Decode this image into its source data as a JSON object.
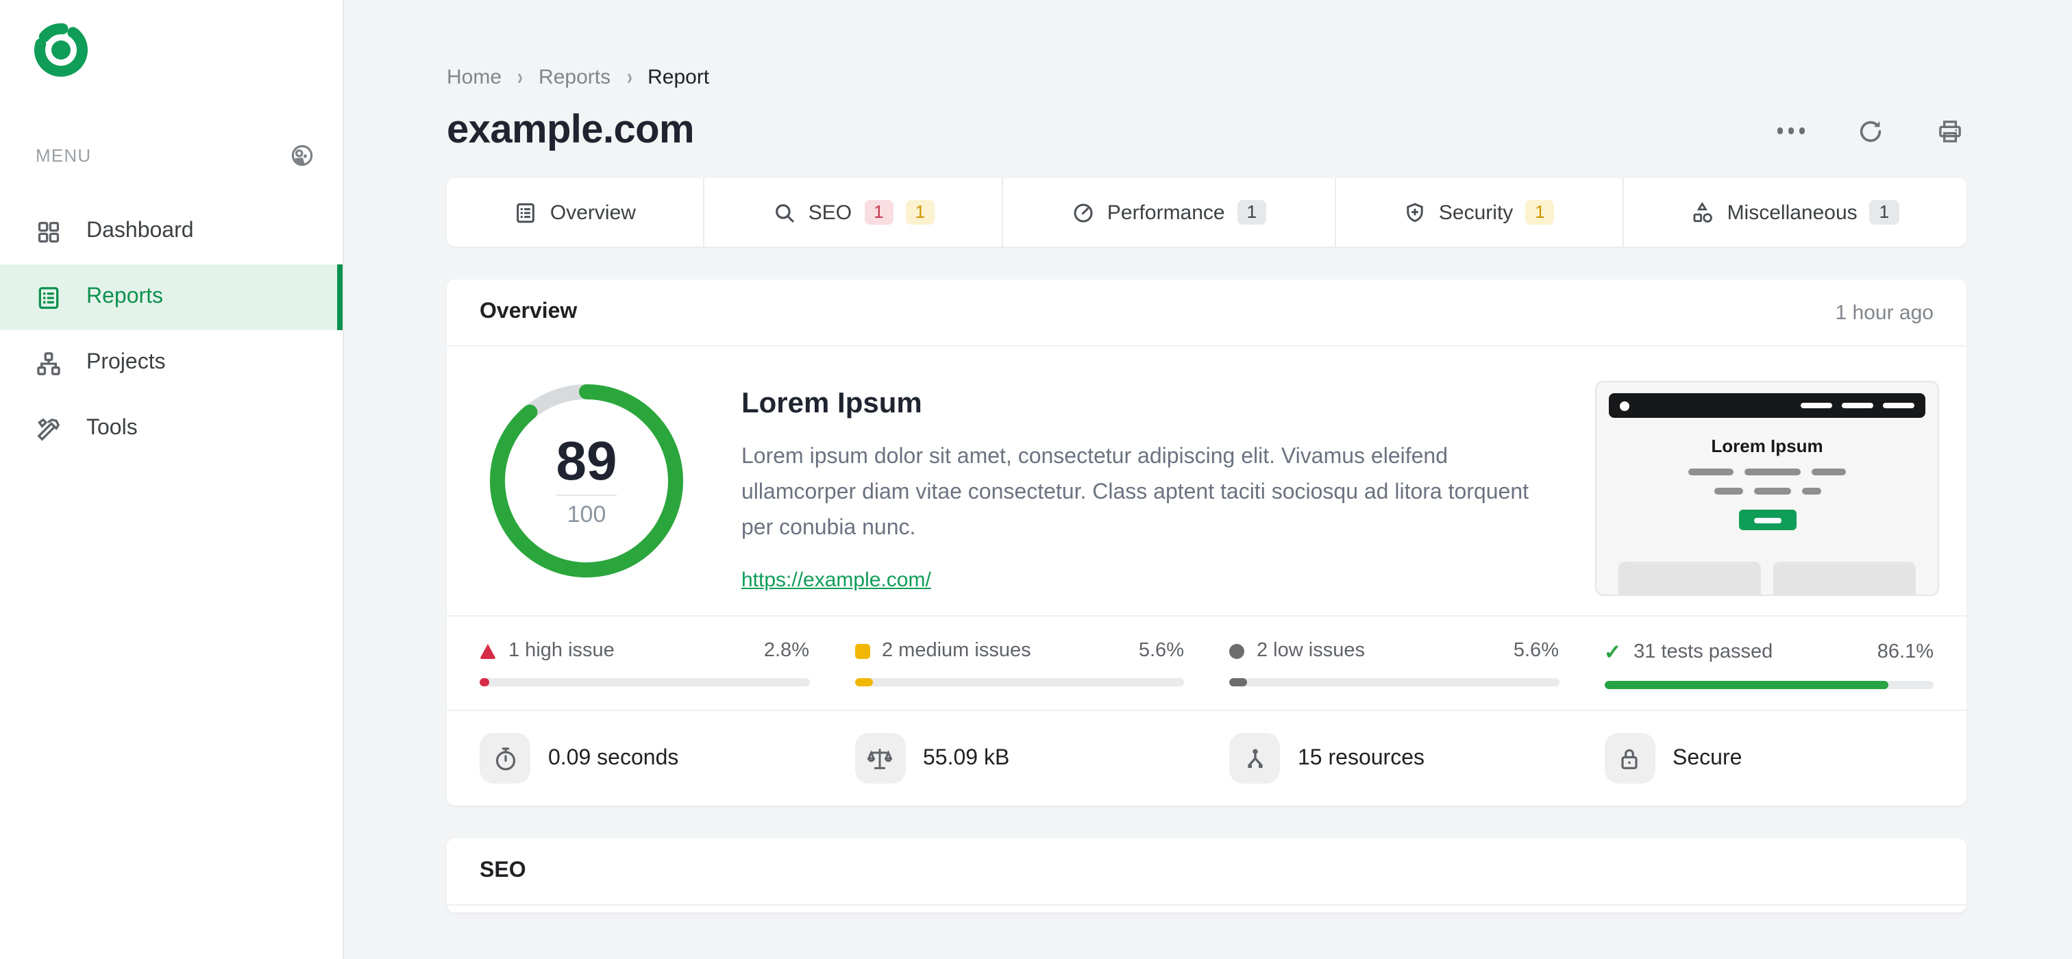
{
  "colors": {
    "brand_green": "#0f9d58",
    "gauge_green": "#2aa63c",
    "active_item_bg": "#e4f3ea",
    "high_red": "#d62b47",
    "medium_amber": "#f2b705",
    "low_gray": "#6d6d6d",
    "passed_green": "#27a343",
    "page_bg": "#f3f4f6"
  },
  "sidebar": {
    "menu_label": "MENU",
    "items": [
      {
        "label": "Dashboard",
        "icon": "grid-icon",
        "active": false
      },
      {
        "label": "Reports",
        "icon": "report-list-icon",
        "active": true
      },
      {
        "label": "Projects",
        "icon": "sitemap-icon",
        "active": false
      },
      {
        "label": "Tools",
        "icon": "tools-icon",
        "active": false
      }
    ]
  },
  "breadcrumb": {
    "items": [
      "Home",
      "Reports",
      "Report"
    ]
  },
  "header": {
    "title": "example.com",
    "actions": [
      "more-options",
      "refresh",
      "print"
    ]
  },
  "tabs": [
    {
      "label": "Overview",
      "icon": "list-icon",
      "badges": []
    },
    {
      "label": "SEO",
      "icon": "search-icon",
      "badges": [
        {
          "text": "1",
          "color": "red"
        },
        {
          "text": "1",
          "color": "yellow"
        }
      ]
    },
    {
      "label": "Performance",
      "icon": "speedometer-icon",
      "badges": [
        {
          "text": "1",
          "color": "gray"
        }
      ]
    },
    {
      "label": "Security",
      "icon": "shield-icon",
      "badges": [
        {
          "text": "1",
          "color": "yellow"
        }
      ]
    },
    {
      "label": "Miscellaneous",
      "icon": "shapes-icon",
      "badges": [
        {
          "text": "1",
          "color": "gray"
        }
      ]
    }
  ],
  "overview": {
    "section_title": "Overview",
    "timestamp": "1 hour ago",
    "score": {
      "value": 89,
      "max": 100
    },
    "heading": "Lorem Ipsum",
    "paragraph": "Lorem ipsum dolor sit amet, consectetur adipiscing elit. Vivamus eleifend ullamcorper diam vitae consectetur. Class aptent taciti sociosqu ad litora torquent per conubia nunc.",
    "link": "https://example.com/",
    "thumbnail_title": "Lorem Ipsum",
    "issues": [
      {
        "label": "1 high issue",
        "percent": "2.8%",
        "value": 2.8,
        "severity": "high"
      },
      {
        "label": "2 medium issues",
        "percent": "5.6%",
        "value": 5.6,
        "severity": "medium"
      },
      {
        "label": "2 low issues",
        "percent": "5.6%",
        "value": 5.6,
        "severity": "low"
      },
      {
        "label": "31 tests passed",
        "percent": "86.1%",
        "value": 86.1,
        "severity": "passed"
      }
    ],
    "quick_stats": [
      {
        "label": "0.09 seconds",
        "icon": "stopwatch-icon"
      },
      {
        "label": "55.09 kB",
        "icon": "scale-icon"
      },
      {
        "label": "15 resources",
        "icon": "resources-icon"
      },
      {
        "label": "Secure",
        "icon": "lock-icon"
      }
    ]
  },
  "seo_section": {
    "title": "SEO"
  }
}
